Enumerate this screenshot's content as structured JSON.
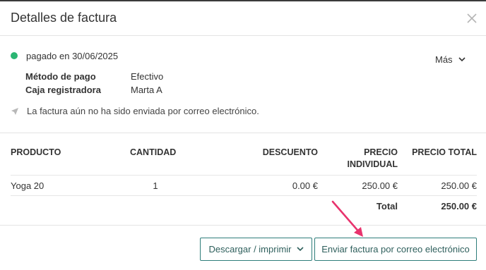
{
  "dialog": {
    "title": "Detalles de factura"
  },
  "status": {
    "text": "pagado en 30/06/2025",
    "color": "#2bb673"
  },
  "more_label": "Más",
  "details": [
    {
      "label": "Método de pago",
      "value": "Efectivo"
    },
    {
      "label": "Caja registradora",
      "value": "Marta A"
    }
  ],
  "email_notice": "La factura aún no ha sido enviada por correo electrónico.",
  "table": {
    "headers": {
      "product": "PRODUCTO",
      "quantity": "CANTIDAD",
      "discount": "DESCUENTO",
      "unit_price_line1": "PRECIO",
      "unit_price_line2": "INDIVIDUAL",
      "total_price": "PRECIO TOTAL"
    },
    "rows": [
      {
        "product": "Yoga 20",
        "quantity": "1",
        "discount": "0.00 €",
        "unit_price": "250.00 €",
        "total_price": "250.00 €"
      }
    ],
    "total_label": "Total",
    "total_value": "250.00 €"
  },
  "actions": {
    "download_label": "Descargar / imprimir",
    "email_label": "Enviar factura por correo electrónico"
  },
  "colors": {
    "accent": "#2e7d7a",
    "annotation_arrow": "#e8336d"
  }
}
